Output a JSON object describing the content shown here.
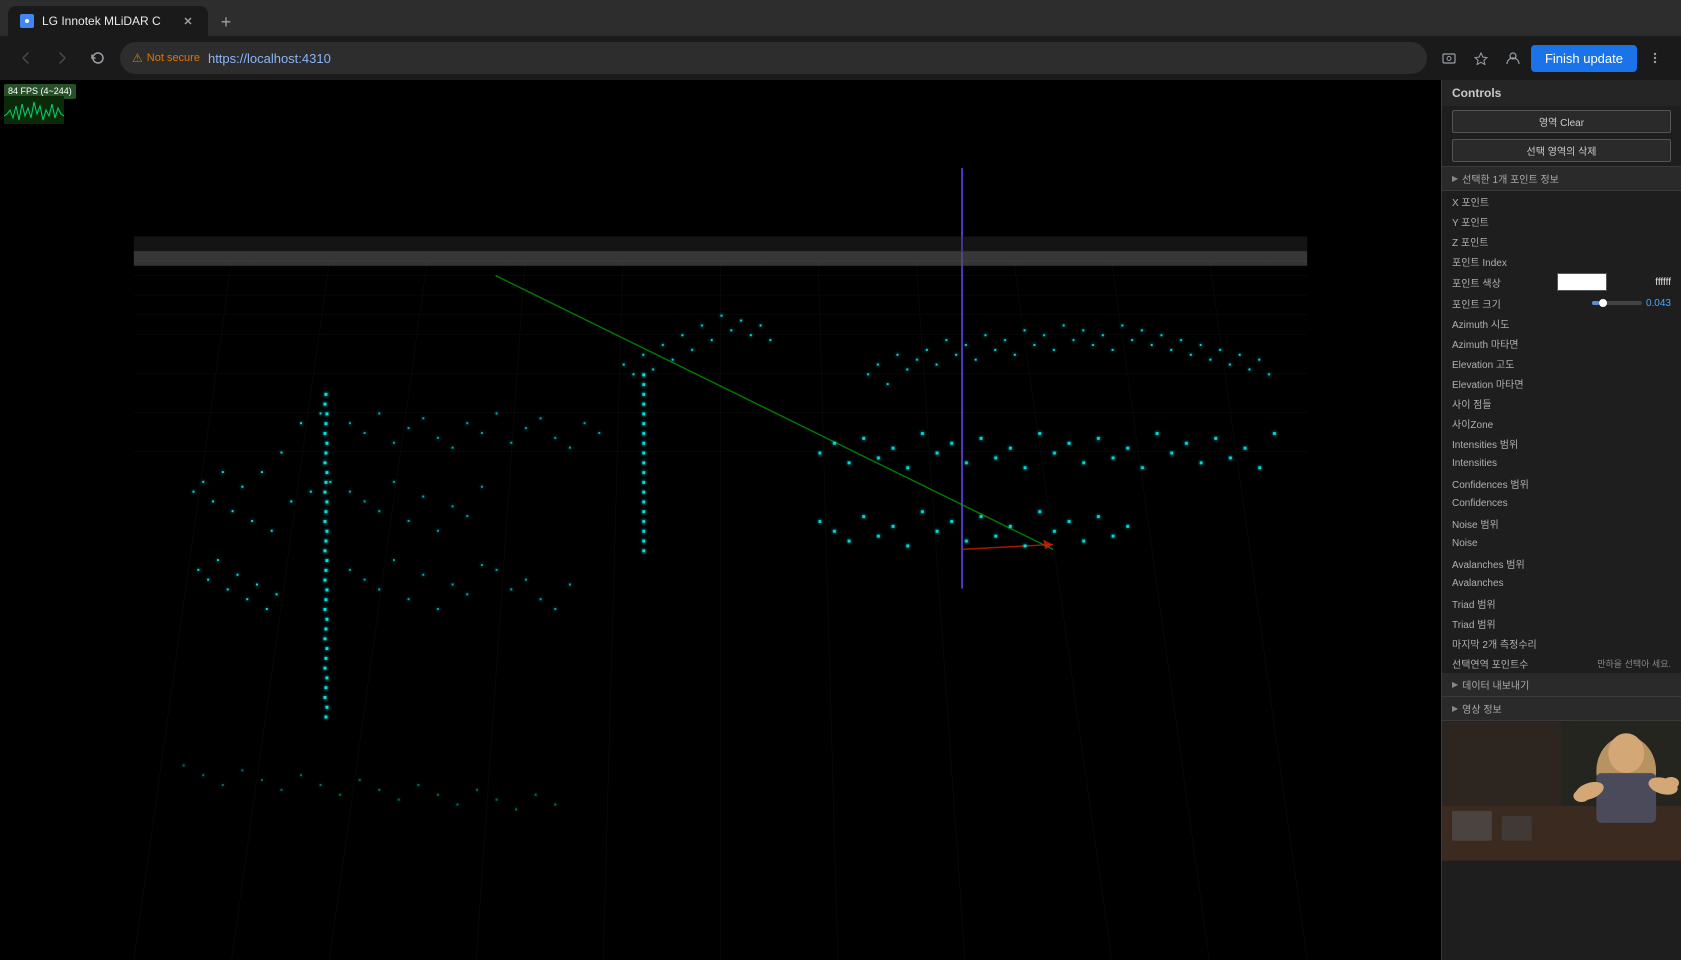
{
  "browser": {
    "tab_title": "LG Innotek MLiDAR C",
    "tab_active": true,
    "address": "https://localhost:4310",
    "security_label": "Not secure",
    "finish_update_label": "Finish update",
    "new_tab_label": "+"
  },
  "fps": {
    "value": "84 FPS (4~244)",
    "badge_bg": "#1a4a1a"
  },
  "controls": {
    "title": "Controls",
    "clear_label": "영역 Clear",
    "delete_selection_label": "선택 영역의 삭제",
    "selected_info_title": "선택한 1개 포인트 정보",
    "x_point": "X 포인트",
    "y_point": "Y 포인트",
    "z_point": "Z 포인트",
    "point_index": "포인트 Index",
    "point_color": "포인트 색상",
    "point_color_value": "ffffff",
    "point_size": "포인트 크기",
    "point_size_value": "0.043",
    "azimuth_start": "Azimuth 시도",
    "azimuth_end": "Azimuth 마타면",
    "elevation_start": "Elevation 고도",
    "elevation_end": "Elevation 마타면",
    "side_point": "사이 점들",
    "side_zone": "사이Zone",
    "intensities_label": "Intensities 범위",
    "intensities": "Intensities",
    "confidences_label": "Confidences 범위",
    "confidences": "Confidences",
    "noise_label": "Noise 범위",
    "noise": "Noise",
    "avalanches_label": "Avalanches 범위",
    "avalanches": "Avalanches",
    "triad_label": "Triad 범위",
    "triad": "Triad 범위",
    "last_measurement": "마지막 2개 측정수리",
    "selected_point_count": "선택연역 포인트수",
    "selected_point_hint": "만하을 선택아 세요.",
    "data_navigation_title": "데이터 내보내기",
    "video_info_title": "영상 정보"
  }
}
